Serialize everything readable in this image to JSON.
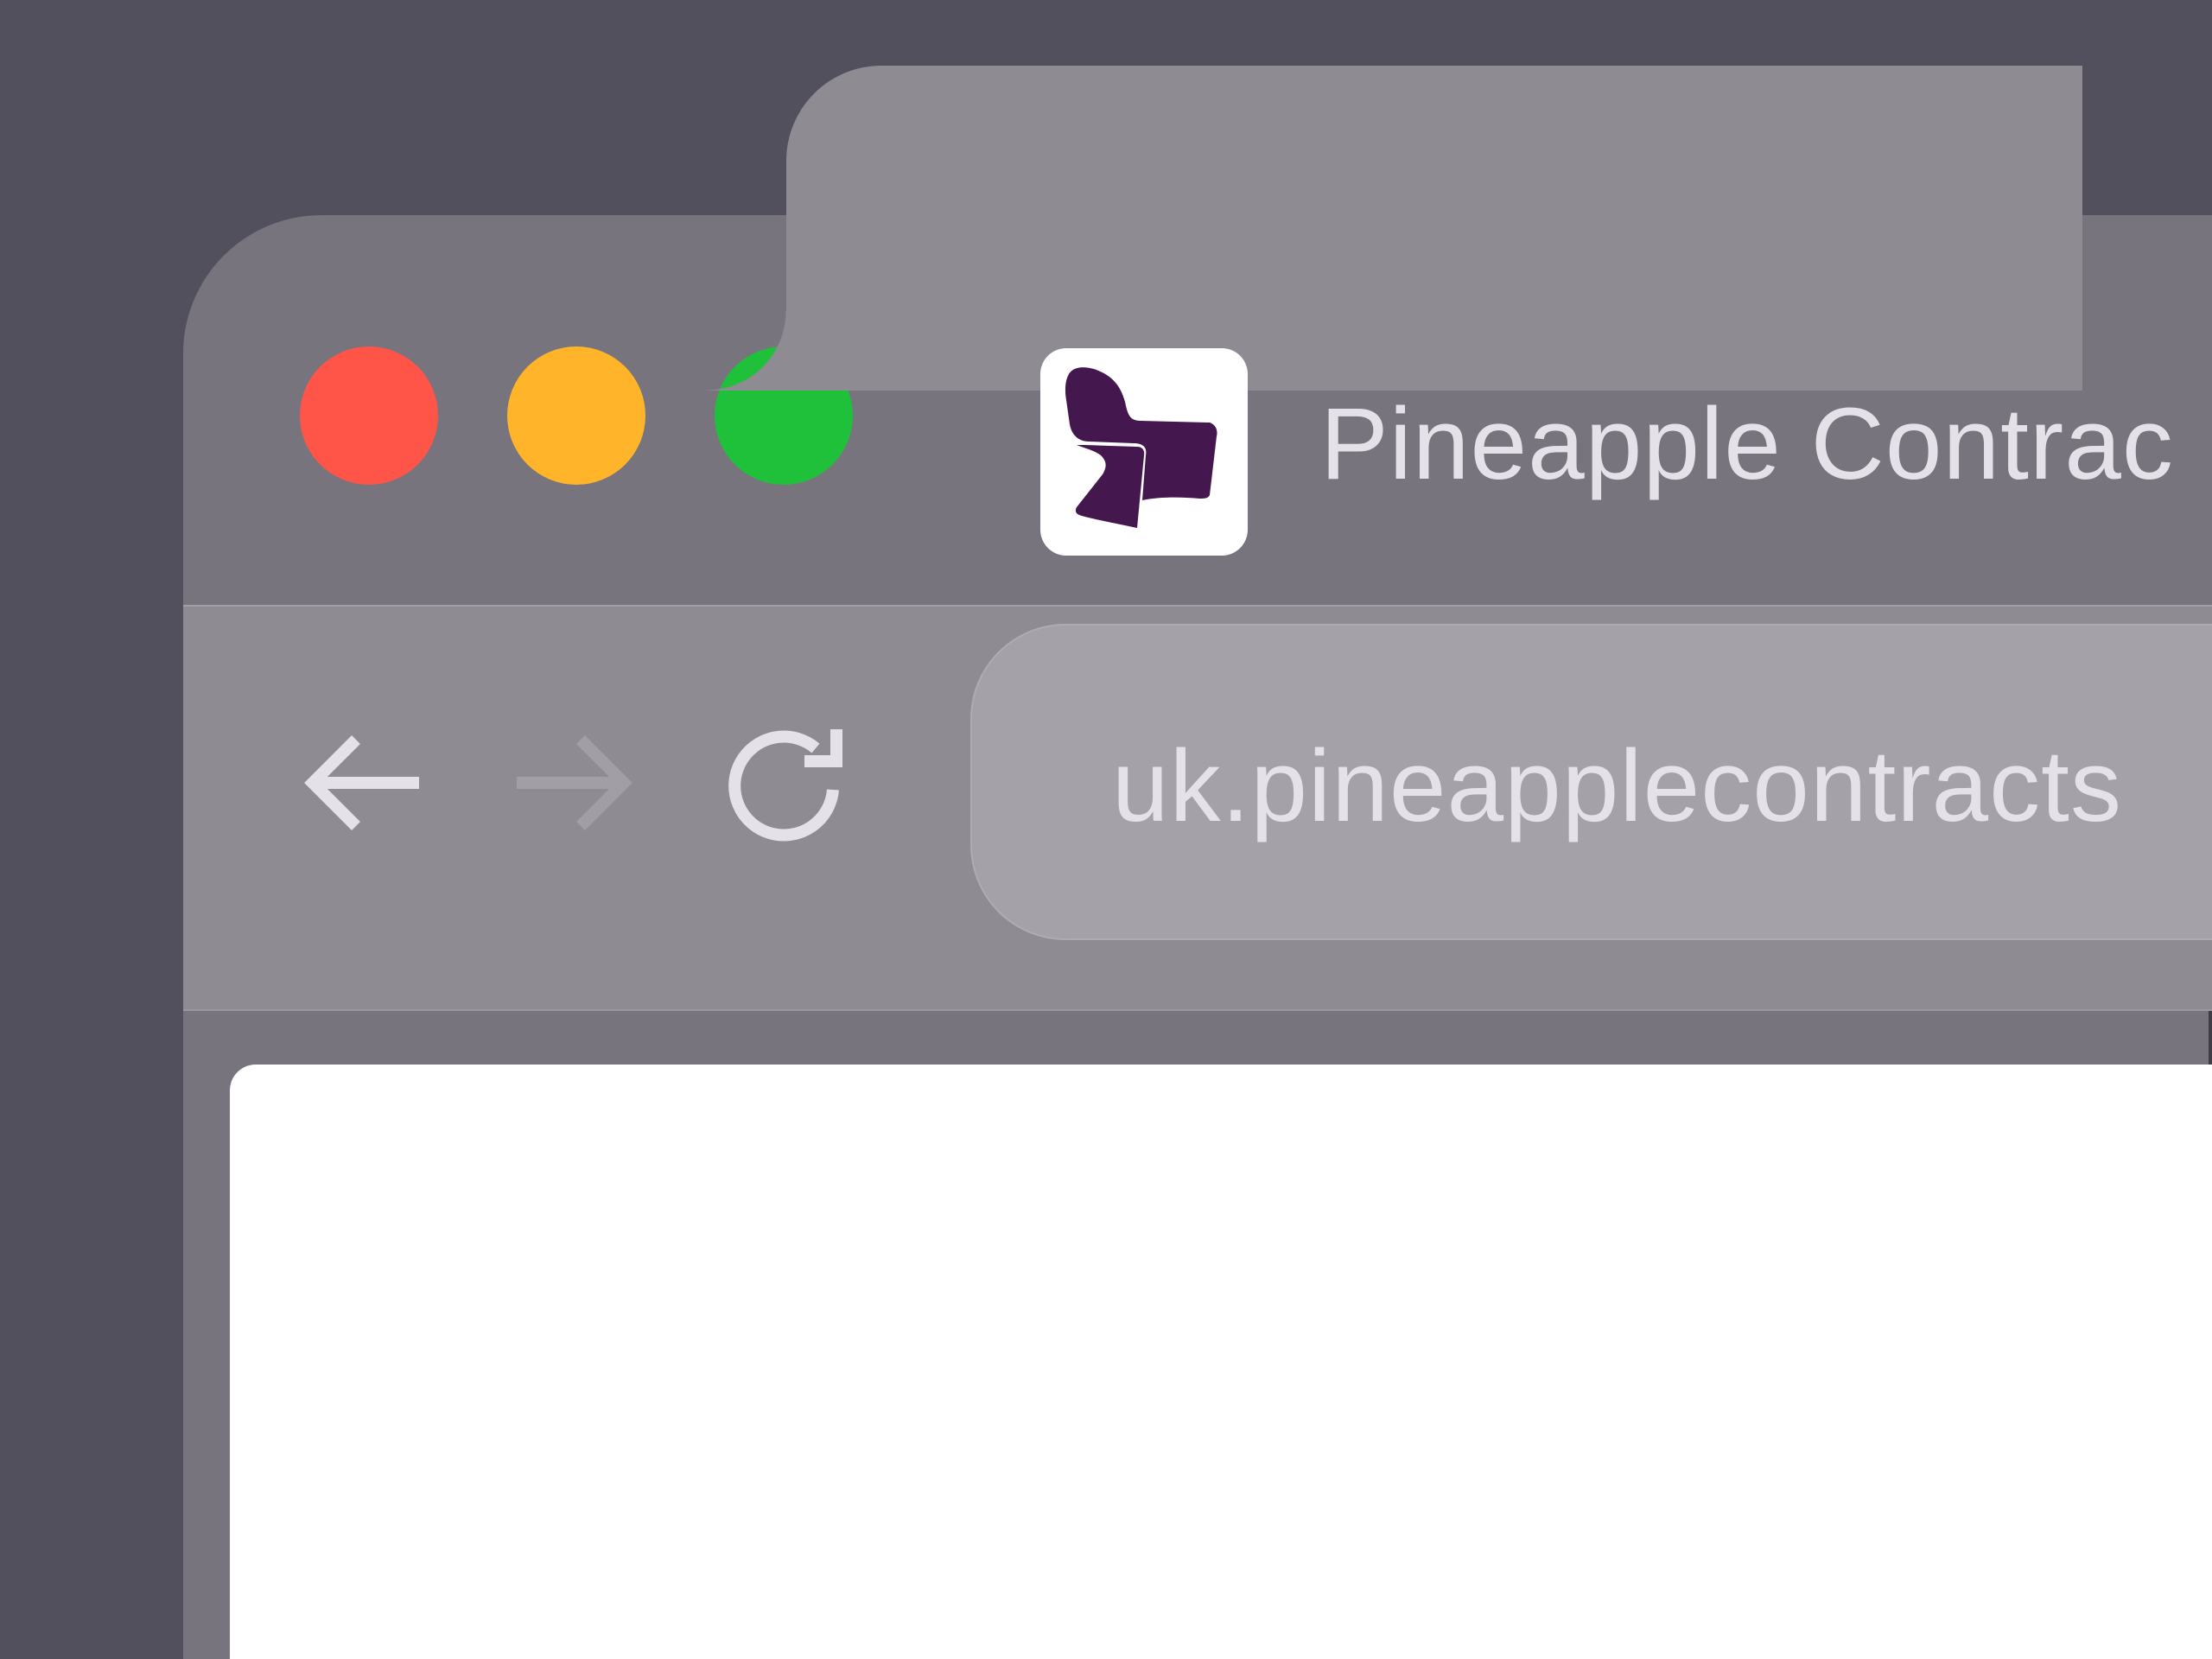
{
  "window": {
    "traffic_lights": [
      {
        "name": "close",
        "color": "#ff5549"
      },
      {
        "name": "minimize",
        "color": "#ffb42a"
      },
      {
        "name": "zoom",
        "color": "#1fc13a"
      }
    ]
  },
  "tab": {
    "title": "Pineapple Contrac",
    "favicon": "pineapple-contracts-chair-logo",
    "favicon_color": "#44184f"
  },
  "toolbar": {
    "back_icon": "arrow-left-icon",
    "forward_icon": "arrow-right-icon",
    "forward_enabled": false,
    "reload_icon": "reload-icon"
  },
  "address_bar": {
    "url": "uk.pineapplecontracts"
  },
  "colors": {
    "desktop": "#53505e",
    "chrome": "#77747e",
    "tab": "#8e8b93",
    "address_bar": "#a4a1a9",
    "text": "#e4e2e8",
    "page": "#ffffff"
  }
}
